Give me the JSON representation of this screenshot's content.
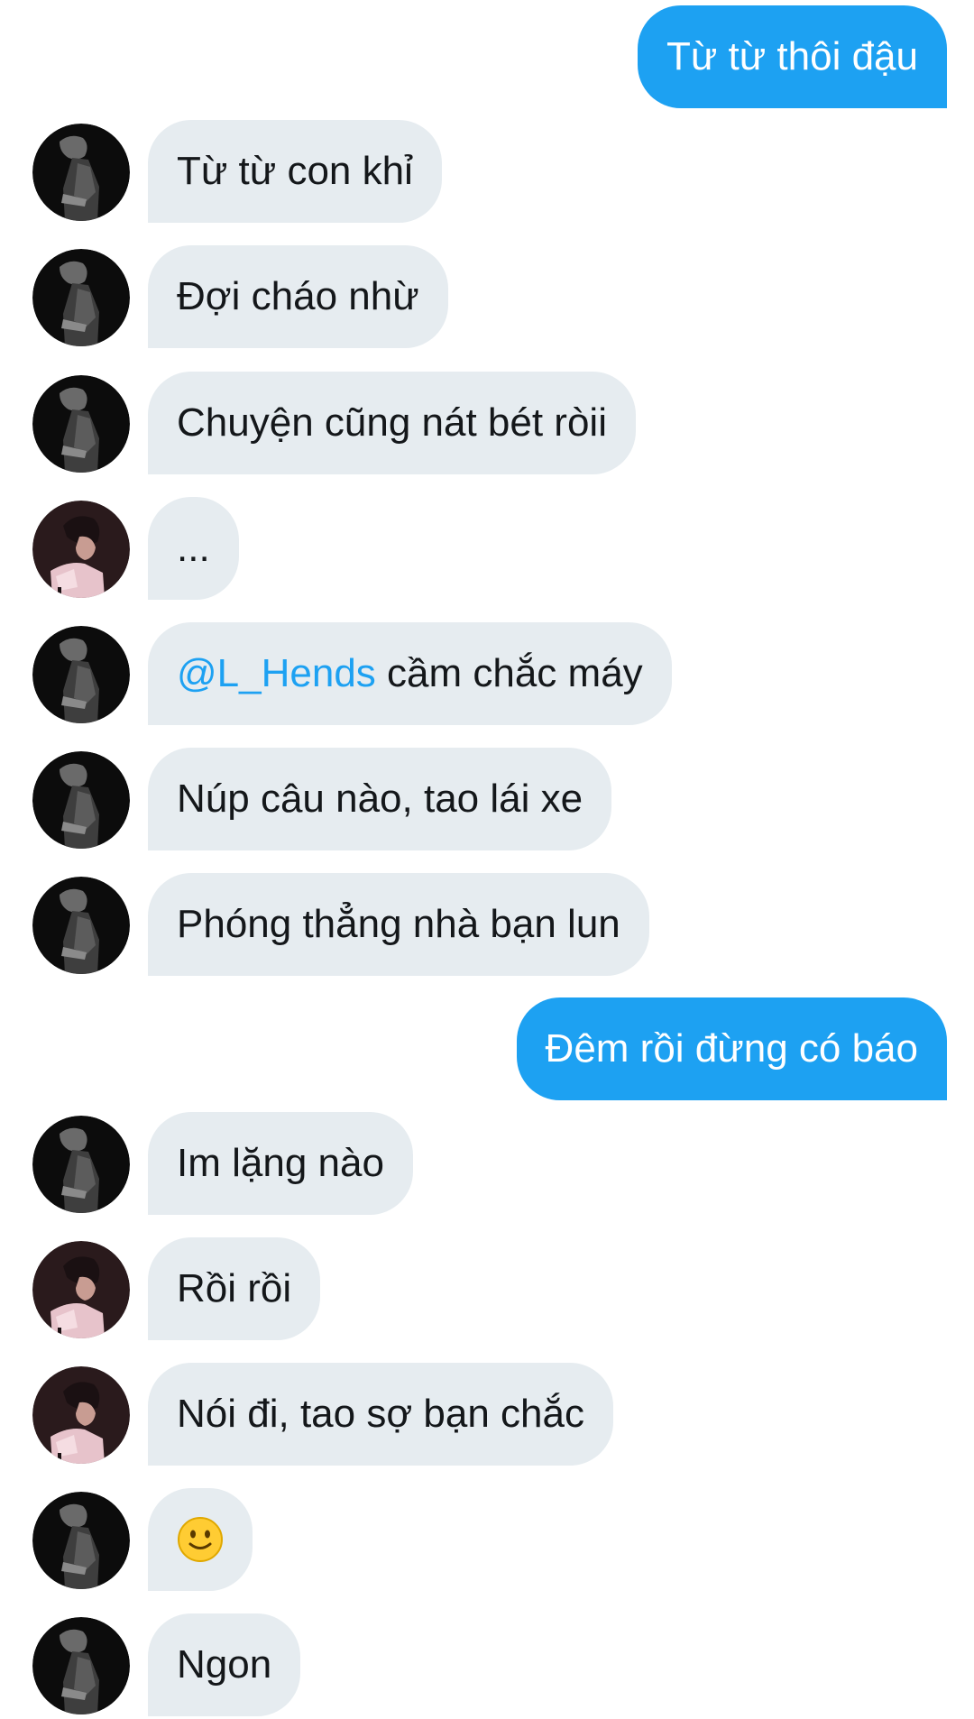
{
  "messages": [
    {
      "side": "out",
      "text": "Từ từ thôi đậu"
    },
    {
      "side": "in",
      "avatar": "dark-avatar",
      "text": "Từ từ con khỉ"
    },
    {
      "side": "in",
      "avatar": "dark-avatar",
      "text": "Đợi cháo nhừ"
    },
    {
      "side": "in",
      "avatar": "dark-avatar",
      "text": "Chuyện cũng nát bét ròii"
    },
    {
      "side": "in",
      "avatar": "pink-avatar",
      "text": "..."
    },
    {
      "side": "in",
      "avatar": "dark-avatar",
      "mention": "@L_Hends",
      "text": " cầm chắc máy"
    },
    {
      "side": "in",
      "avatar": "dark-avatar",
      "text": "Núp câu nào, tao lái xe"
    },
    {
      "side": "in",
      "avatar": "dark-avatar",
      "text": "Phóng thẳng nhà bạn lun"
    },
    {
      "side": "out",
      "text": "Đêm rồi đừng có báo"
    },
    {
      "side": "in",
      "avatar": "dark-avatar",
      "text": "Im lặng nào"
    },
    {
      "side": "in",
      "avatar": "pink-avatar",
      "text": "Rồi rồi"
    },
    {
      "side": "in",
      "avatar": "pink-avatar",
      "text": "Nói đi, tao sợ bạn chắc"
    },
    {
      "side": "in",
      "avatar": "dark-avatar",
      "emoji": "slightly-smiling-face-icon"
    },
    {
      "side": "in",
      "avatar": "dark-avatar",
      "text": "Ngon"
    }
  ],
  "colors": {
    "outgoing_bubble": "#1da1f2",
    "incoming_bubble": "#e6ecf0",
    "mention": "#1da1f2",
    "text": "#14171a"
  }
}
